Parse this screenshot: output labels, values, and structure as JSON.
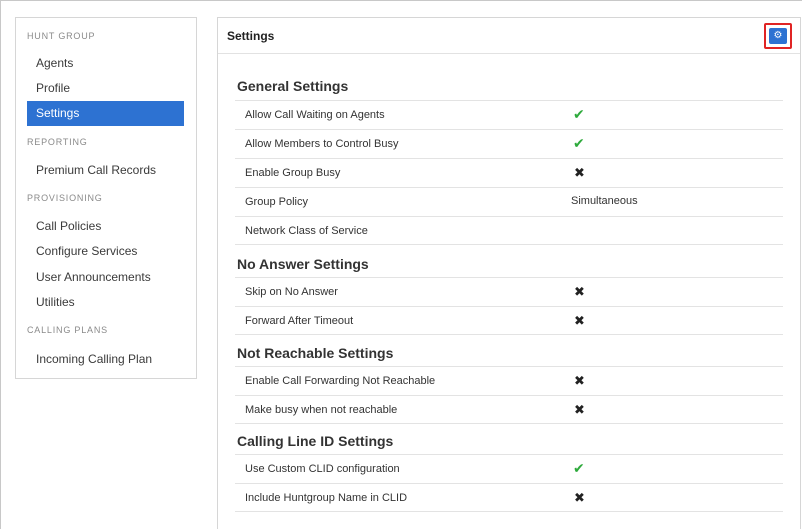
{
  "sidebar": {
    "sections": [
      {
        "title": "HUNT GROUP",
        "items": [
          "Agents",
          "Profile",
          "Settings"
        ]
      },
      {
        "title": "REPORTING",
        "items": [
          "Premium Call Records"
        ]
      },
      {
        "title": "PROVISIONING",
        "items": [
          "Call Policies",
          "Configure Services",
          "User Announcements",
          "Utilities"
        ]
      },
      {
        "title": "CALLING PLANS",
        "items": [
          "Incoming Calling Plan"
        ]
      }
    ],
    "active_item": "Settings"
  },
  "main": {
    "title": "Settings",
    "settings_button_icon": "gear-icon",
    "groups": [
      {
        "title": "General Settings",
        "rows": [
          {
            "label": "Allow Call Waiting on Agents",
            "value": "check"
          },
          {
            "label": "Allow Members to Control Busy",
            "value": "check"
          },
          {
            "label": "Enable Group Busy",
            "value": "cross"
          },
          {
            "label": "Group Policy",
            "value": "Simultaneous"
          },
          {
            "label": "Network Class of Service",
            "value": ""
          }
        ]
      },
      {
        "title": "No Answer Settings",
        "rows": [
          {
            "label": "Skip on No Answer",
            "value": "cross"
          },
          {
            "label": "Forward After Timeout",
            "value": "cross"
          }
        ]
      },
      {
        "title": "Not Reachable Settings",
        "rows": [
          {
            "label": "Enable Call Forwarding Not Reachable",
            "value": "cross"
          },
          {
            "label": "Make busy when not reachable",
            "value": "cross"
          }
        ]
      },
      {
        "title": "Calling Line ID Settings",
        "rows": [
          {
            "label": "Use Custom CLID configuration",
            "value": "check"
          },
          {
            "label": "Include Huntgroup Name in CLID",
            "value": "cross"
          }
        ]
      }
    ]
  },
  "colors": {
    "accent": "#2d72d2",
    "check": "#2eaa3c",
    "highlight": "#e02424"
  }
}
